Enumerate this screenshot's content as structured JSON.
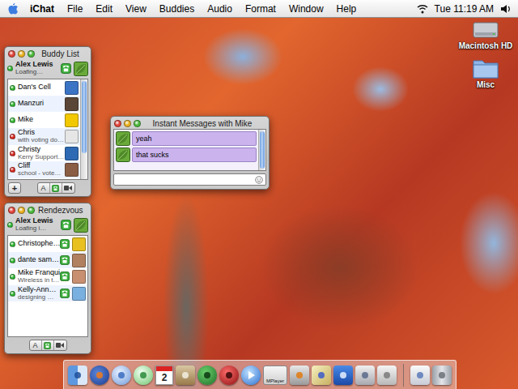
{
  "menubar": {
    "app": "iChat",
    "menus": [
      "File",
      "Edit",
      "View",
      "Buddies",
      "Audio",
      "Format",
      "Window",
      "Help"
    ],
    "clock": "Tue 11:19 AM"
  },
  "desktop_icons": [
    {
      "label": "Macintosh HD",
      "kind": "drive"
    },
    {
      "label": "Misc",
      "kind": "folder"
    }
  ],
  "buddy_list": {
    "title": "Buddy List",
    "me": {
      "name": "Alex Lewis",
      "status": "Loafing…",
      "color": "#2fb52f",
      "audio": true
    },
    "buddies": [
      {
        "name": "Dan's Cell",
        "status": "",
        "color": "#2fb52f",
        "audio": false
      },
      {
        "name": "Manzuri",
        "status": "",
        "color": "#2fb52f",
        "audio": false
      },
      {
        "name": "Mike",
        "status": "",
        "color": "#2fb52f",
        "audio": false
      },
      {
        "name": "Chris",
        "status": "with voting do…",
        "color": "#d8261c",
        "audio": false
      },
      {
        "name": "Christy",
        "status": "Kerry Support…",
        "color": "#d8261c",
        "audio": false
      },
      {
        "name": "Cliff",
        "status": "school - vote…",
        "color": "#d8261c",
        "audio": false
      }
    ],
    "add_label": "+",
    "text_chat_label": "A"
  },
  "rendezvous": {
    "title": "Rendezvous",
    "me": {
      "name": "Alex Lewis",
      "status": "Loafing i…",
      "color": "#2fb52f",
      "audio": true
    },
    "buddies": [
      {
        "name": "Christophe…",
        "status": "",
        "color": "#2fb52f",
        "audio": true
      },
      {
        "name": "dante sam…",
        "status": "",
        "color": "#2fb52f",
        "audio": true
      },
      {
        "name": "Mike Franqui",
        "status": "Wireless in t…",
        "color": "#2fb52f",
        "audio": true
      },
      {
        "name": "Kelly-Ann…",
        "status": "designing …",
        "color": "#2fb52f",
        "audio": true
      }
    ],
    "add_label": "",
    "text_chat_label": "A"
  },
  "chat": {
    "title": "Instant Messages with Mike",
    "messages": [
      {
        "text": "yeah"
      },
      {
        "text": "that sucks"
      }
    ],
    "input": {
      "value": ""
    }
  },
  "dock": {
    "items": [
      {
        "kind": "finder",
        "text": ""
      },
      {
        "kind": "firefox",
        "text": ""
      },
      {
        "kind": "ichat",
        "text": ""
      },
      {
        "kind": "itunes",
        "text": ""
      },
      {
        "kind": "ical",
        "text": "2"
      },
      {
        "kind": "signpost",
        "text": ""
      },
      {
        "kind": "dreamweaver",
        "text": ""
      },
      {
        "kind": "dvd",
        "text": ""
      },
      {
        "kind": "quicktime",
        "text": ""
      },
      {
        "kind": "mplayer",
        "text": "MPlayer"
      },
      {
        "kind": "vlc",
        "text": ""
      },
      {
        "kind": "pencil",
        "text": ""
      },
      {
        "kind": "word",
        "text": ""
      },
      {
        "kind": "network",
        "text": ""
      },
      {
        "kind": "apple",
        "text": ""
      },
      {
        "kind": "separator",
        "text": ""
      },
      {
        "kind": "window",
        "text": ""
      },
      {
        "kind": "trash",
        "text": ""
      }
    ]
  }
}
